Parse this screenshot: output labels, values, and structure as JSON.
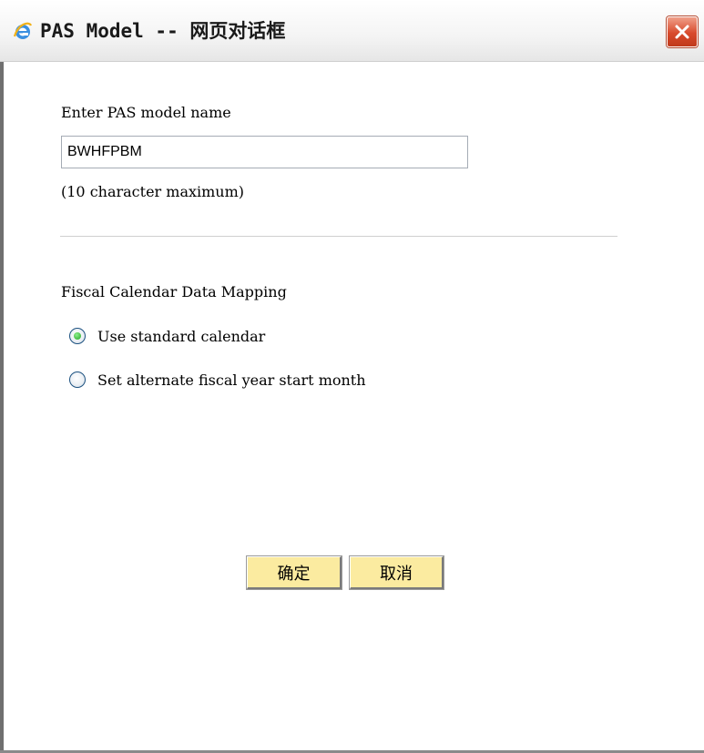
{
  "window": {
    "title": "PAS Model -- 网页对话框",
    "icon": "ie-icon",
    "close_icon": "close-icon"
  },
  "form": {
    "name_label": "Enter PAS model name",
    "name_value": "BWHFPBM",
    "name_hint": "(10 character maximum)",
    "calendar_heading": "Fiscal Calendar Data Mapping",
    "options": [
      {
        "label": "Use standard calendar",
        "selected": true
      },
      {
        "label": "Set alternate fiscal year start month",
        "selected": false
      }
    ]
  },
  "buttons": {
    "ok_label": "确定",
    "cancel_label": "取消"
  },
  "colors": {
    "button_bg": "#fbeba0",
    "close_bg": "#d84a2c",
    "radio_selected": "#22a422"
  }
}
